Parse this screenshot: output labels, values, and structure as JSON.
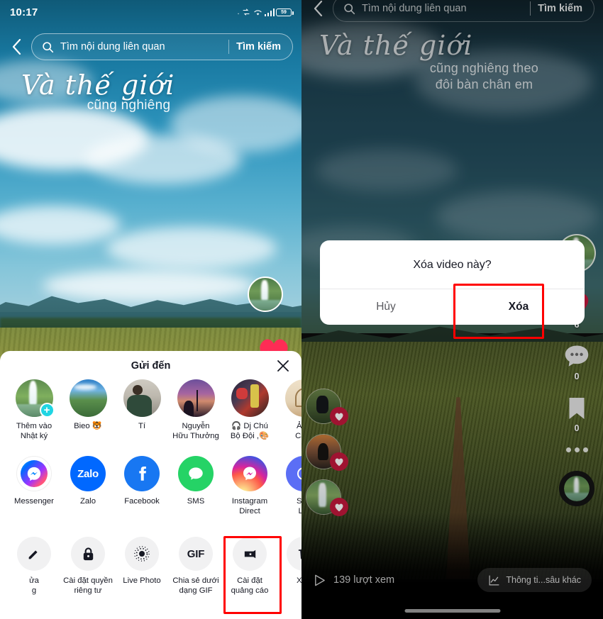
{
  "left_panel": {
    "status_bar": {
      "time": "10:17",
      "battery_level": "59"
    },
    "search": {
      "placeholder": "Tìm nội dung liên quan",
      "button_label": "Tìm kiếm",
      "search_icon": "search-icon",
      "back_icon": "chevron-left-icon"
    },
    "overlay_text": {
      "script": "Và thế giới",
      "sub": "cũng nghiêng"
    },
    "share_sheet": {
      "title": "Gửi đến",
      "close_icon": "close-icon",
      "contacts": [
        {
          "name": "Thêm vào\nNhật ký",
          "art": "art-falls",
          "badge": "+"
        },
        {
          "name": "Bieo 🐯",
          "art": "art-lake",
          "badge": ""
        },
        {
          "name": "Tí",
          "art": "art-man",
          "badge": ""
        },
        {
          "name": "Nguyễn\nHữu Thưởng",
          "art": "art-bridge",
          "badge": ""
        },
        {
          "name": "🎧 Dj Chú\nBộ Đội ,🎨",
          "art": "art-dj",
          "badge": ""
        },
        {
          "name": "Ảnh\nCảm",
          "art": "art-cream",
          "badge": ""
        }
      ],
      "apps": [
        {
          "name": "Messenger",
          "icon": "messenger-icon",
          "class": "ic-messenger"
        },
        {
          "name": "Zalo",
          "icon": "zalo-icon",
          "class": "ic-zalo",
          "text": "Zalo"
        },
        {
          "name": "Facebook",
          "icon": "facebook-icon",
          "class": "ic-fb"
        },
        {
          "name": "SMS",
          "icon": "sms-icon",
          "class": "ic-sms"
        },
        {
          "name": "Instagram\nDirect",
          "icon": "instagram-icon",
          "class": "ic-ig"
        },
        {
          "name": "Sao\nLiê",
          "icon": "copy-link-icon",
          "class": "ic-save"
        }
      ],
      "actions": [
        {
          "name": "ửa\ng",
          "icon": "edit-icon"
        },
        {
          "name": "Cài đặt quyền\nriêng tư",
          "icon": "lock-icon"
        },
        {
          "name": "Live Photo",
          "icon": "live-photo-icon"
        },
        {
          "name": "Chia sẻ dưới\ndạng GIF",
          "icon": "gif-icon",
          "text": "GIF"
        },
        {
          "name": "Cài đặt\nquảng cáo",
          "icon": "promote-icon"
        },
        {
          "name": "Xóa",
          "icon": "trash-icon",
          "highlighted": true
        }
      ]
    }
  },
  "right_panel": {
    "search": {
      "placeholder": "Tìm nội dung liên quan",
      "button_label": "Tìm kiếm",
      "search_icon": "search-icon",
      "back_icon": "chevron-left-icon"
    },
    "overlay_text": {
      "script": "Và thế giới",
      "sub_line1": "cũng nghiêng theo",
      "sub_line2": "đôi bàn chân em"
    },
    "dialog": {
      "title": "Xóa video này?",
      "cancel_label": "Hủy",
      "confirm_label": "Xóa",
      "confirm_highlighted": true
    },
    "rail": {
      "avatar_icon": "profile-avatar",
      "like": {
        "icon": "heart-icon",
        "count": "6"
      },
      "comment": {
        "icon": "comment-icon",
        "count": "0"
      },
      "bookmark": {
        "icon": "bookmark-icon",
        "count": "0"
      },
      "more_icon": "more-dots-icon",
      "music_disc_icon": "music-disc-icon"
    },
    "mini_thumbs": [
      {
        "art": "art-m1",
        "badge_icon": "heart-icon"
      },
      {
        "art": "art-m2",
        "badge_icon": "heart-icon"
      },
      {
        "art": "art-m3",
        "badge_icon": "heart-icon"
      }
    ],
    "bottom_bar": {
      "views_icon": "play-icon",
      "views_text": "139 lượt xem",
      "analytics_icon": "chart-line-icon",
      "analytics_label": "Thông ti...sâu khác"
    }
  },
  "colors": {
    "highlight_red": "#ff0000",
    "tiktok_pink": "#fe2c55",
    "badge_cyan": "#20d5e3",
    "heart_rail": "#c2183c"
  }
}
